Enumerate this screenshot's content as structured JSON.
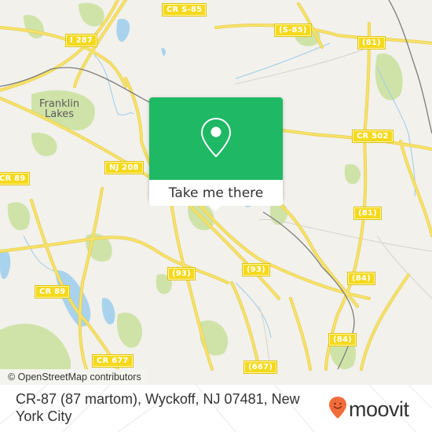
{
  "map": {
    "place_labels": [
      {
        "id": "franklin-lakes",
        "text": "Franklin\nLakes"
      }
    ],
    "road_labels": [
      {
        "id": "cr-s85-top",
        "text": "CR S-85"
      },
      {
        "id": "i287",
        "text": "I 287"
      },
      {
        "id": "s85",
        "text": "(S-85)"
      },
      {
        "id": "r81-top",
        "text": "(81)"
      },
      {
        "id": "cr502",
        "text": "CR 502"
      },
      {
        "id": "nj208",
        "text": "NJ 208"
      },
      {
        "id": "cr89-left",
        "text": "CR 89"
      },
      {
        "id": "r81-mid",
        "text": "(81)"
      },
      {
        "id": "r93-left",
        "text": "(93)"
      },
      {
        "id": "r93-right",
        "text": "(93)"
      },
      {
        "id": "r84-top",
        "text": "(84)"
      },
      {
        "id": "cr89",
        "text": "CR 89"
      },
      {
        "id": "r84-bottom",
        "text": "(84)"
      },
      {
        "id": "cr677",
        "text": "CR 677"
      },
      {
        "id": "r667",
        "text": "(667)"
      }
    ],
    "attribution": "© OpenStreetMap contributors",
    "colors": {
      "land": "#f2f1ec",
      "park": "#cfe3a8",
      "water": "#a9d3ec",
      "road": "#f7e26b",
      "road_label_bg": "#f5d91b",
      "popup": "#1fb865"
    }
  },
  "popup": {
    "icon": "map-pin-icon",
    "action_label": "Take me there"
  },
  "footer": {
    "address": "CR-87 (87 martom), Wyckoff, NJ 07481, New York City",
    "brand": "moovit",
    "brand_icon": "moovit-smiley-pin-icon",
    "brand_color": "#f26b3a"
  }
}
